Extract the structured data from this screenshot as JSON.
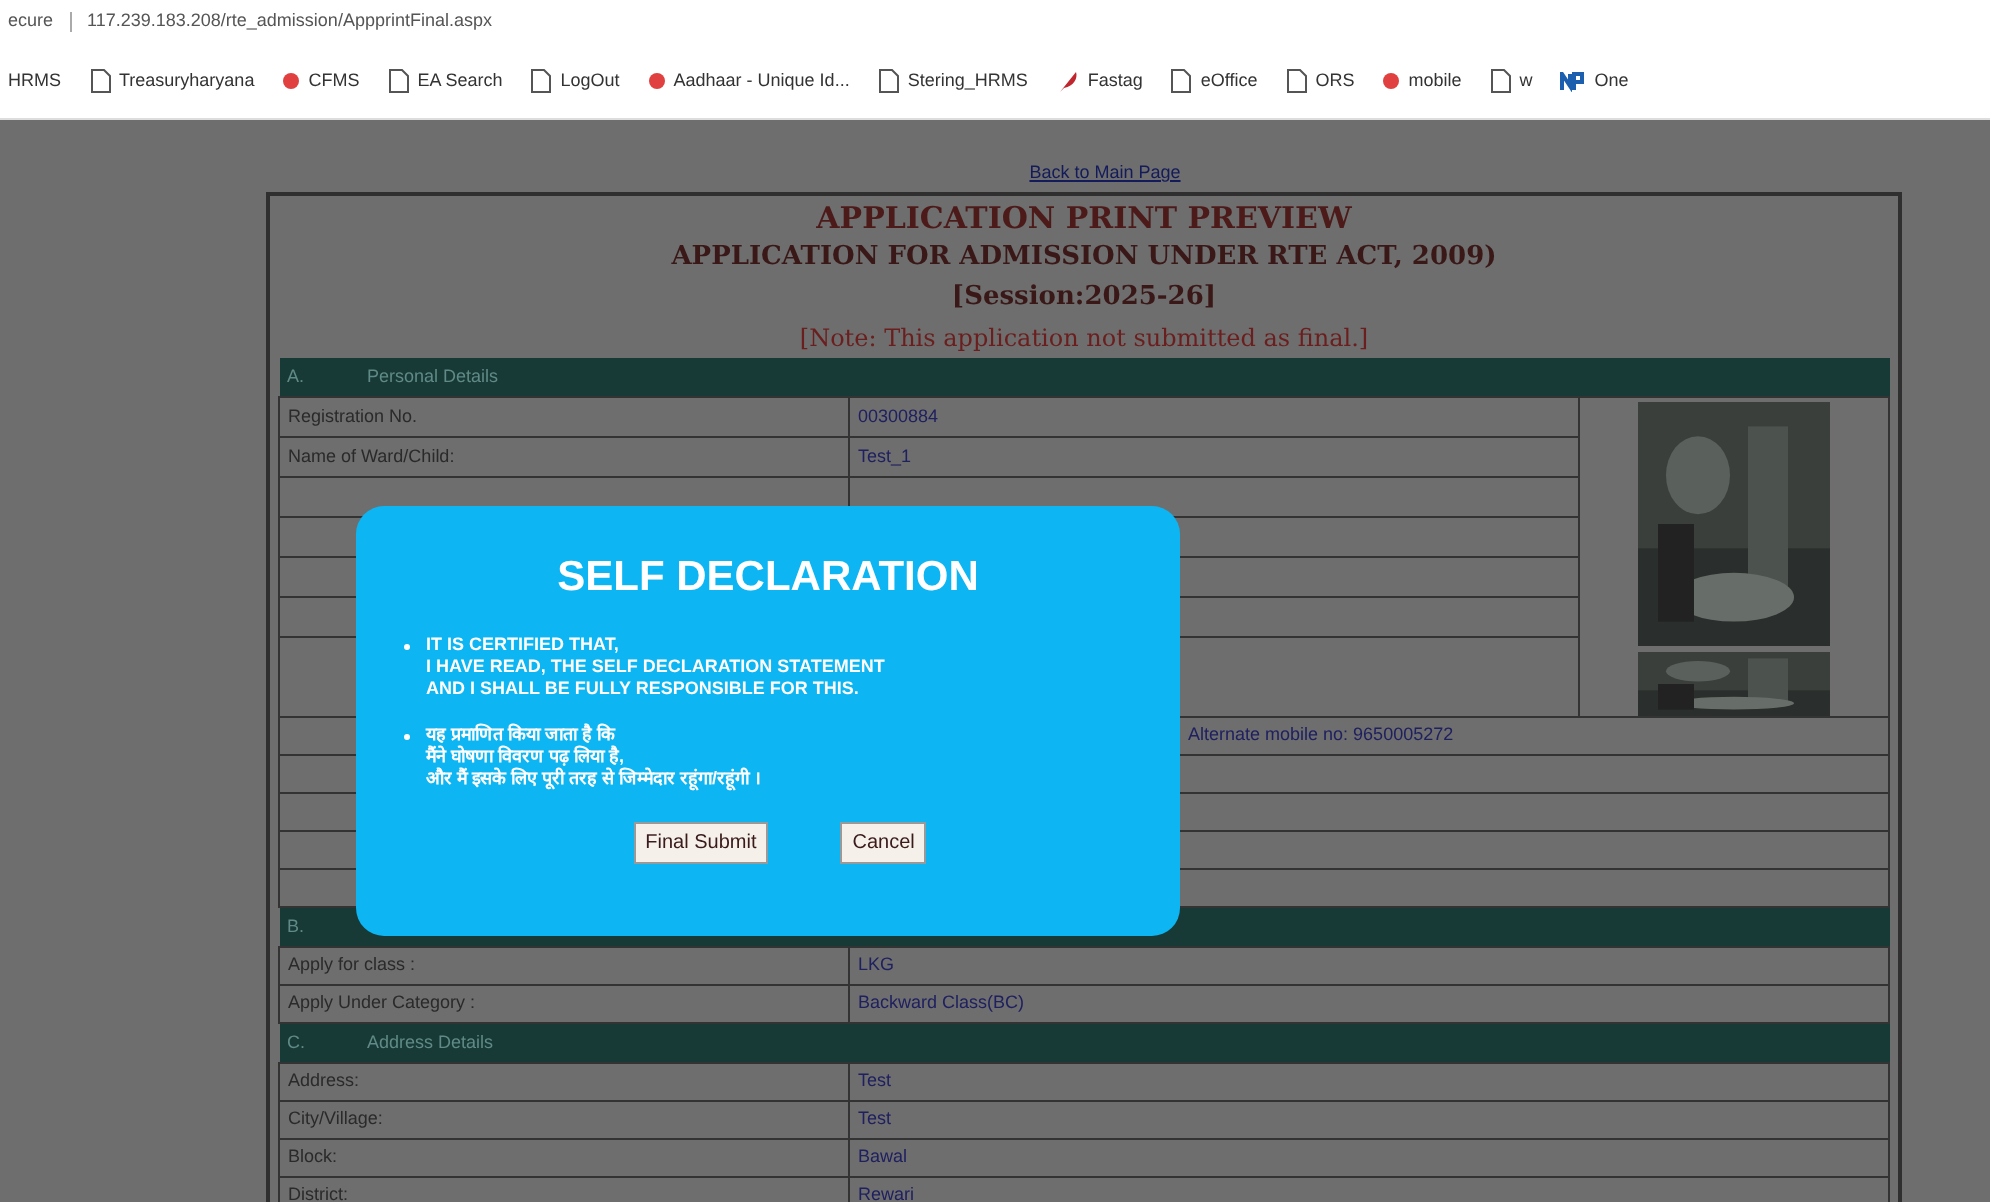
{
  "browser": {
    "address_prefix": "ecure",
    "url": "117.239.183.208/rte_admission/AppprintFinal.aspx"
  },
  "bookmarks": [
    {
      "label": "HRMS",
      "kind": "plain"
    },
    {
      "label": "Treasuryharyana",
      "kind": "page"
    },
    {
      "label": "CFMS",
      "kind": "dot"
    },
    {
      "label": "EA Search",
      "kind": "page"
    },
    {
      "label": "LogOut",
      "kind": "page"
    },
    {
      "label": "Aadhaar - Unique Id...",
      "kind": "dot"
    },
    {
      "label": "Stering_HRMS",
      "kind": "page"
    },
    {
      "label": "Fastag",
      "kind": "feather"
    },
    {
      "label": "eOffice",
      "kind": "page"
    },
    {
      "label": "ORS",
      "kind": "page"
    },
    {
      "label": "mobile",
      "kind": "dot"
    },
    {
      "label": "w",
      "kind": "page"
    },
    {
      "label": "One",
      "kind": "brand"
    }
  ],
  "back_link": "Back to Main Page",
  "header": {
    "title": "APPLICATION PRINT PREVIEW",
    "subtitle": "APPLICATION FOR ADMISSION UNDER RTE ACT, 2009)",
    "session": "[Session:2025-26]",
    "note": "[Note: This application not submitted as final.]"
  },
  "sections": [
    {
      "letter": "A.",
      "title": "Personal Details",
      "rows": [
        {
          "label": "Registration No.",
          "value": "00300884"
        },
        {
          "label": "Name of Ward/Child:",
          "value": "Test_1"
        },
        {},
        {},
        {},
        {},
        {
          "kind": "tall"
        },
        {
          "value": "Alternate mobile no: 9650005272"
        },
        {},
        {},
        {},
        {}
      ]
    },
    {
      "letter": "B.",
      "rows": [
        {
          "label": "Apply for class :",
          "value": "LKG"
        },
        {
          "label": "Apply Under Category :",
          "value": "Backward Class(BC)"
        }
      ]
    },
    {
      "letter": "C.",
      "title": "Address Details",
      "rows": [
        {
          "label": "Address:",
          "value": "Test"
        },
        {
          "label": "City/Village:",
          "value": "Test"
        },
        {
          "label": "Block:",
          "value": "Bawal"
        },
        {
          "label": "District:",
          "value": "Rewari"
        }
      ]
    }
  ],
  "dialog": {
    "title": "SELF DECLARATION",
    "statements": [
      {
        "lines": [
          "IT IS CERTIFIED THAT,",
          "I HAVE READ, THE SELF DECLARATION STATEMENT",
          "AND I SHALL BE FULLY RESPONSIBLE FOR THIS."
        ]
      },
      {
        "lines": [
          "यह प्रमाणित किया जाता है कि",
          "मैंने घोषणा विवरण पढ़ लिया है,",
          "और मैं इसके लिए पूरी तरह से जिम्मेदार रहूंगा/रहूंगी ।"
        ]
      }
    ],
    "buttons": [
      "Final Submit",
      "Cancel"
    ]
  }
}
